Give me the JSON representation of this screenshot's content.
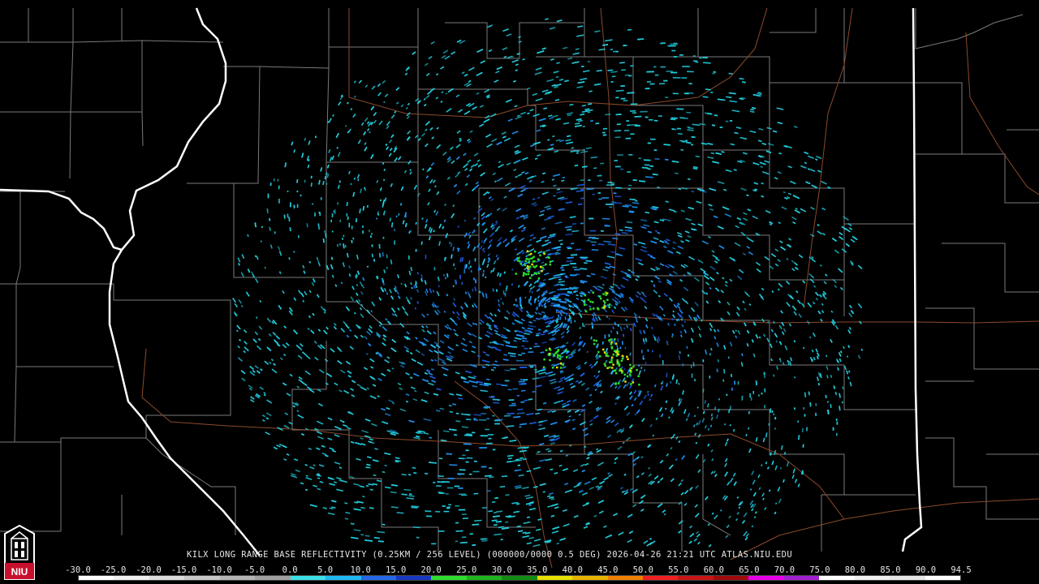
{
  "product": {
    "title": "KILX LONG RANGE BASE REFLECTIVITY (0.25KM / 256 LEVEL) (000000/0000 0.5 DEG) 2026-04-26 21:21 UTC  ATLAS.NIU.EDU",
    "radar_site": "KILX"
  },
  "logo": {
    "text": "NIU",
    "color": "#c8102e"
  },
  "colors": {
    "background": "#000000",
    "county_lines": "#7a7a7a",
    "state_lines": "#ffffff",
    "highways": "#8b4a2b",
    "echo_primary": "#22cfe0"
  },
  "legend": {
    "labels": [
      "-30.0",
      "-25.0",
      "-20.0",
      "-15.0",
      "-10.0",
      "-5.0",
      "0.0",
      "5.0",
      "10.0",
      "15.0",
      "20.0",
      "25.0",
      "30.0",
      "35.0",
      "40.0",
      "45.0",
      "50.0",
      "55.0",
      "60.0",
      "65.0",
      "70.0",
      "75.0",
      "80.0",
      "85.0",
      "90.0",
      "94.5"
    ],
    "colors": [
      "#ffffff",
      "#f0f0f0",
      "#dcdcdc",
      "#c8c8c8",
      "#b4b4b4",
      "#a0a0a0",
      "#3be0e6",
      "#20b8f0",
      "#2468e8",
      "#1638c0",
      "#2edc2e",
      "#1eb41e",
      "#128c12",
      "#e8e000",
      "#e8b400",
      "#f08000",
      "#f02020",
      "#c81414",
      "#a00a0a",
      "#e800e8",
      "#a020d0",
      "#ffffff",
      "#f0f0f0",
      "#e6e6e6",
      "#ffffff"
    ]
  }
}
